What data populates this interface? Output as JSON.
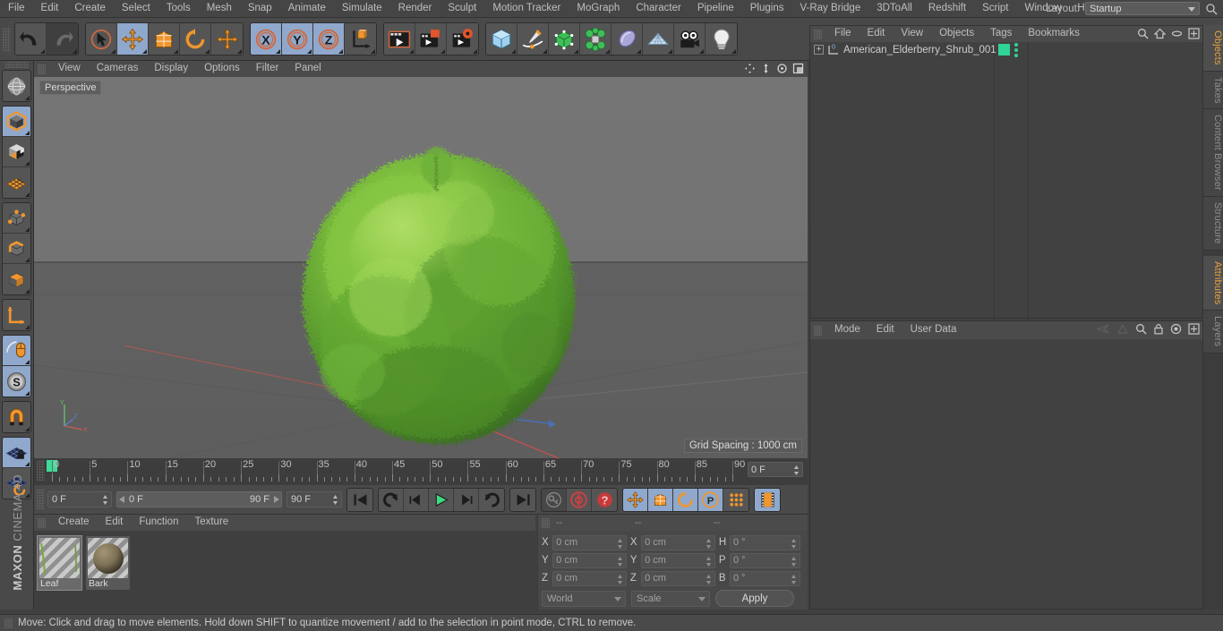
{
  "menubar": {
    "items": [
      "File",
      "Edit",
      "Create",
      "Select",
      "Tools",
      "Mesh",
      "Snap",
      "Animate",
      "Simulate",
      "Render",
      "Sculpt",
      "Motion Tracker",
      "MoGraph",
      "Character",
      "Pipeline",
      "Plugins",
      "V-Ray Bridge",
      "3DToAll",
      "Redshift",
      "Script",
      "Window",
      "Help"
    ],
    "layout_label": "Layout:",
    "layout_value": "Startup",
    "search_icon": "search-icon"
  },
  "toolbar": {
    "groups": [
      {
        "name": "undo-redo",
        "buttons": [
          {
            "name": "undo-button",
            "icon": "undo-arrow-icon",
            "state": "normal"
          },
          {
            "name": "redo-button",
            "icon": "redo-arrow-icon",
            "state": "disabled"
          }
        ]
      },
      {
        "name": "transform-tools",
        "buttons": [
          {
            "name": "select-tool-button",
            "icon": "cursor-select-icon",
            "state": "normal"
          },
          {
            "name": "move-tool-button",
            "icon": "move-arrows-icon",
            "state": "active"
          },
          {
            "name": "scale-tool-button",
            "icon": "scale-box-icon",
            "state": "normal"
          },
          {
            "name": "rotate-tool-button",
            "icon": "rotate-circle-icon",
            "state": "normal"
          },
          {
            "name": "free-move-button",
            "icon": "move-arrows-icon",
            "state": "normal"
          }
        ]
      },
      {
        "name": "axis-locks",
        "buttons": [
          {
            "name": "lock-x-button",
            "icon": "axis-x-icon",
            "state": "active"
          },
          {
            "name": "lock-y-button",
            "icon": "axis-y-icon",
            "state": "active"
          },
          {
            "name": "lock-z-button",
            "icon": "axis-z-icon",
            "state": "active"
          },
          {
            "name": "world-object-axis-button",
            "icon": "world-axis-icon",
            "state": "normal"
          }
        ]
      },
      {
        "name": "render-tools",
        "buttons": [
          {
            "name": "render-view-button",
            "icon": "render-view-icon",
            "state": "normal"
          },
          {
            "name": "render-region-button",
            "icon": "render-region-icon",
            "state": "normal"
          },
          {
            "name": "render-settings-button",
            "icon": "render-settings-icon",
            "state": "normal"
          }
        ]
      },
      {
        "name": "create-objects",
        "buttons": [
          {
            "name": "add-primitive-button",
            "icon": "cube-icon",
            "state": "normal"
          },
          {
            "name": "add-spline-button",
            "icon": "pen-spline-icon",
            "state": "normal"
          },
          {
            "name": "add-generator-button",
            "icon": "green-cube-icon",
            "state": "normal"
          },
          {
            "name": "add-deformer-button",
            "icon": "green-cluster-icon",
            "state": "normal"
          },
          {
            "name": "add-scene-object-button",
            "icon": "purple-blob-icon",
            "state": "normal"
          },
          {
            "name": "add-floor-button",
            "icon": "grid-floor-icon",
            "state": "normal"
          },
          {
            "name": "add-camera-button",
            "icon": "camera-icon",
            "state": "normal"
          },
          {
            "name": "add-light-button",
            "icon": "lightbulb-icon",
            "state": "normal"
          }
        ]
      }
    ]
  },
  "left_toolbar": {
    "groups": [
      {
        "name": "viewport-mode",
        "buttons": [
          {
            "name": "make-editable-button",
            "icon": "globe-wire-icon",
            "state": "normal"
          }
        ]
      },
      {
        "name": "editor-modes",
        "buttons": [
          {
            "name": "model-mode-button",
            "icon": "model-cube-icon",
            "state": "active"
          },
          {
            "name": "texture-mode-button",
            "icon": "texture-checker-cube-icon",
            "state": "normal"
          },
          {
            "name": "workplane-mode-button",
            "icon": "workplane-grid-icon",
            "state": "normal"
          }
        ]
      },
      {
        "name": "component-modes",
        "buttons": [
          {
            "name": "points-mode-button",
            "icon": "points-cube-icon",
            "state": "normal"
          },
          {
            "name": "edges-mode-button",
            "icon": "edges-cube-icon",
            "state": "normal"
          },
          {
            "name": "polygons-mode-button",
            "icon": "polygons-cube-icon",
            "state": "normal"
          }
        ]
      },
      {
        "name": "axis-tools",
        "buttons": [
          {
            "name": "enable-axis-button",
            "icon": "axis-L-icon",
            "state": "normal"
          }
        ]
      },
      {
        "name": "snap-tools",
        "buttons": [
          {
            "name": "soft-selection-button",
            "icon": "mouse-falloff-icon",
            "state": "active"
          },
          {
            "name": "snap-settings-button",
            "icon": "snap-s-icon",
            "state": "active"
          }
        ]
      },
      {
        "name": "magnet-group",
        "buttons": [
          {
            "name": "magnet-tool-button",
            "icon": "magnet-icon",
            "state": "normal"
          }
        ]
      },
      {
        "name": "workplane-group",
        "buttons": [
          {
            "name": "lock-workplane-button",
            "icon": "workplane-lock-icon",
            "state": "active"
          },
          {
            "name": "planar-workplane-button",
            "icon": "workplane-rotate-icon",
            "state": "normal"
          }
        ]
      }
    ],
    "brand_bold": "MAXON",
    "brand_light": "CINEMA 4D"
  },
  "viewport": {
    "menu": [
      "View",
      "Cameras",
      "Display",
      "Options",
      "Filter",
      "Panel"
    ],
    "label": "Perspective",
    "grid_spacing": "Grid Spacing : 1000 cm",
    "axis_labels": {
      "x": "X",
      "y": "Y",
      "z": "Z"
    },
    "header_icons": [
      "pan-icon",
      "dolly-icon",
      "orbit-icon",
      "maximize-icon"
    ]
  },
  "timeline": {
    "ticks": [
      0,
      5,
      10,
      15,
      20,
      25,
      30,
      35,
      40,
      45,
      50,
      55,
      60,
      65,
      70,
      75,
      80,
      85,
      90
    ],
    "start": 0,
    "end": 90,
    "current_frame_field": "0 F"
  },
  "playback": {
    "current_frame": "0 F",
    "range_start": "0 F",
    "range_end": "90 F",
    "max_frame": "90 F",
    "buttons": [
      {
        "name": "go-to-start-button",
        "icon": "skip-start-icon",
        "state": "normal"
      },
      {
        "name": "previous-keyframe-button",
        "icon": "prev-keyframe-icon",
        "state": "normal"
      },
      {
        "name": "step-back-button",
        "icon": "step-back-icon",
        "state": "normal"
      },
      {
        "name": "play-button",
        "icon": "play-icon",
        "state": "normal"
      },
      {
        "name": "step-forward-button",
        "icon": "step-forward-icon",
        "state": "normal"
      },
      {
        "name": "next-keyframe-button",
        "icon": "next-keyframe-icon",
        "state": "normal"
      },
      {
        "name": "go-to-end-button",
        "icon": "skip-end-icon",
        "state": "normal"
      },
      {
        "name": "record-active-objects-button",
        "icon": "key-icon",
        "state": "disabled"
      },
      {
        "name": "autokeying-button",
        "icon": "autokey-circle-icon",
        "state": "normal"
      },
      {
        "name": "keyframe-selection-button",
        "icon": "question-circle-icon",
        "state": "normal"
      },
      {
        "name": "record-position-button",
        "icon": "position-move-icon",
        "state": "active"
      },
      {
        "name": "record-scale-button",
        "icon": "scale-icon",
        "state": "active"
      },
      {
        "name": "record-rotation-button",
        "icon": "rotation-icon",
        "state": "active"
      },
      {
        "name": "record-pla-button",
        "icon": "pla-p-icon",
        "state": "active"
      },
      {
        "name": "record-parameter-button",
        "icon": "param-dots-icon",
        "state": "normal"
      },
      {
        "name": "timeline-button",
        "icon": "film-strip-icon",
        "state": "active"
      }
    ]
  },
  "material_manager": {
    "menu": [
      "Create",
      "Edit",
      "Function",
      "Texture"
    ],
    "materials": [
      {
        "name": "Leaf",
        "selected": true,
        "swatch_type": "leaf"
      },
      {
        "name": "Bark",
        "selected": false,
        "swatch_type": "bark"
      }
    ]
  },
  "coordinates": {
    "header": [
      "--",
      "--",
      "--"
    ],
    "rows": [
      {
        "axis1": "X",
        "val1": "0 cm",
        "axis2": "X",
        "val2": "0 cm",
        "axis3": "H",
        "val3": "0 °"
      },
      {
        "axis1": "Y",
        "val1": "0 cm",
        "axis2": "Y",
        "val2": "0 cm",
        "axis3": "P",
        "val3": "0 °"
      },
      {
        "axis1": "Z",
        "val1": "0 cm",
        "axis2": "Z",
        "val2": "0 cm",
        "axis3": "B",
        "val3": "0 °"
      }
    ],
    "coord_system": "World",
    "transform_mode": "Scale",
    "apply_label": "Apply"
  },
  "object_manager": {
    "menu": [
      "File",
      "Edit",
      "View",
      "Objects",
      "Tags",
      "Bookmarks"
    ],
    "header_icons": [
      "search-icon",
      "home-icon",
      "ellipse-icon",
      "fit-icon"
    ],
    "objects": [
      {
        "name": "American_Elderberry_Shrub_001",
        "layer_badge": "0",
        "tag_color": "#2fd396"
      }
    ]
  },
  "attributes_manager": {
    "menu": [
      "Mode",
      "Edit",
      "User Data"
    ],
    "header_icons": [
      "prev-page-icon",
      "next-page-icon",
      "search-icon",
      "lock-icon",
      "target-icon",
      "fit-icon"
    ]
  },
  "right_tabs": {
    "top": [
      {
        "label": "Objects",
        "active": true
      },
      {
        "label": "Takes",
        "active": false
      },
      {
        "label": "Content Browser",
        "active": false
      },
      {
        "label": "Structure",
        "active": false
      }
    ],
    "bottom": [
      {
        "label": "Attributes",
        "active": true
      },
      {
        "label": "Layers",
        "active": false
      }
    ]
  },
  "statusbar": {
    "message": "Move: Click and drag to move elements. Hold down SHIFT to quantize movement / add to the selection in point mode, CTRL to remove."
  },
  "colors": {
    "accent_orange": "#e8a33d",
    "active_blue": "#8fa8cc",
    "tag_green": "#2fd396",
    "playhead_green": "#3ddc97"
  }
}
